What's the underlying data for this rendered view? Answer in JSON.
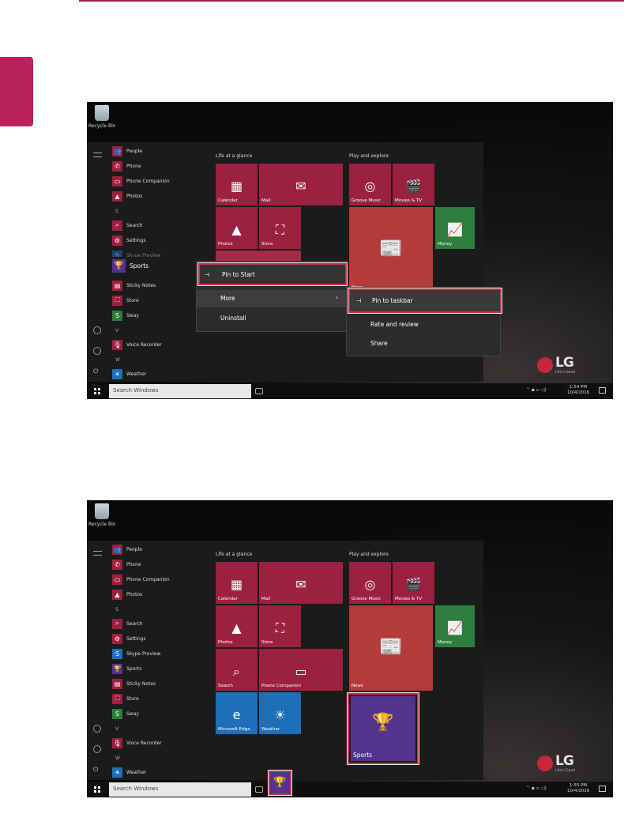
{
  "colors": {
    "accent": "#a31f4c",
    "tile_magenta": "#9c2140",
    "tile_green": "#2d7d3c",
    "tile_blue": "#1e6fb8",
    "tile_purple": "#52348e",
    "highlight": "#c9334f"
  },
  "desktop": {
    "recycle_bin": "Recycle Bin"
  },
  "brand": {
    "logo": "LG",
    "tagline": "Life's Good"
  },
  "groups": {
    "life": "Life at a glance",
    "play": "Play and explore"
  },
  "tiles": {
    "calendar": "Calendar",
    "mail": "Mail",
    "photos": "Photos",
    "store": "Store",
    "groove": "Groove Music",
    "movies": "Movies & TV",
    "money": "Money",
    "news": "News",
    "search": "Search",
    "phone_companion": "Phone Companion",
    "edge": "Microsoft Edge",
    "weather": "Weather",
    "sports": "Sports"
  },
  "apps": {
    "people": "People",
    "phone": "Phone",
    "phone_companion": "Phone Companion",
    "photos": "Photos",
    "letter_s": "S",
    "search": "Search",
    "settings": "Settings",
    "skype": "Skype Preview",
    "sports": "Sports",
    "sticky": "Sticky Notes",
    "store": "Store",
    "sway": "Sway",
    "letter_v": "V",
    "voice": "Voice Recorder",
    "letter_w": "W",
    "weather": "Weather"
  },
  "context_menu": {
    "pin_start": "Pin to Start",
    "more": "More",
    "uninstall": "Uninstall"
  },
  "submenu": {
    "pin_taskbar": "Pin to taskbar",
    "rate": "Rate and review",
    "share": "Share"
  },
  "taskbar": {
    "search_placeholder": "Search Windows"
  },
  "shot1": {
    "time": "1:54 PM",
    "date": "10/4/2016"
  },
  "shot2": {
    "time": "1:55 PM",
    "date": "10/4/2016"
  }
}
